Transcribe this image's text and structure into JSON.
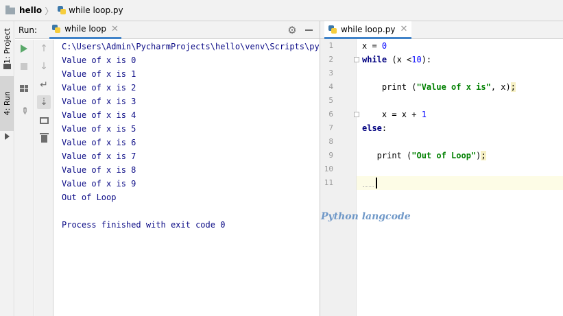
{
  "breadcrumb": {
    "project": "hello",
    "file": "while loop.py"
  },
  "left_strip": {
    "project_tab": "1: Project",
    "run_tab": "4: Run"
  },
  "run_panel": {
    "label": "Run:",
    "tab_label": "while loop",
    "close_glyph": "✕",
    "icons": {
      "settings": "gear-icon",
      "minimize": "minimize-icon",
      "rerun": "rerun-icon",
      "stop": "stop-icon",
      "up": "up-arrow-icon",
      "down": "down-arrow-icon",
      "soft_wrap": "soft-wrap-icon",
      "scroll_to_end": "scroll-to-end-icon",
      "print": "print-icon",
      "clear": "trash-icon",
      "layout": "layout-icon",
      "pin": "pin-icon"
    },
    "console_lines": [
      "C:\\Users\\Admin\\PycharmProjects\\hello\\venv\\Scripts\\pyth",
      "Value of x is 0",
      "Value of x is 1",
      "Value of x is 2",
      "Value of x is 3",
      "Value of x is 4",
      "Value of x is 5",
      "Value of x is 6",
      "Value of x is 7",
      "Value of x is 8",
      "Value of x is 9",
      "Out of Loop",
      "",
      "Process finished with exit code 0"
    ]
  },
  "editor": {
    "tab_label": "while loop.py",
    "close_glyph": "✕",
    "line_numbers": [
      "1",
      "2",
      "3",
      "4",
      "5",
      "6",
      "7",
      "8",
      "9",
      "10",
      "11"
    ],
    "code": {
      "l1_pre": "x = ",
      "l1_num": "0",
      "l2_kw": "while",
      "l2_pre": " (x <",
      "l2_num": "10",
      "l2_post": "):",
      "l4_pre": "    print (",
      "l4_str": "\"Value of x is\"",
      "l4_post": ", x)",
      "l4_semi": ";",
      "l6_pre": "    x = x + ",
      "l6_num": "1",
      "l7_kw": "else",
      "l7_post": ":",
      "l9_pre": "   print (",
      "l9_str": "\"Out of Loop\"",
      "l9_post": ")",
      "l9_semi": ";"
    }
  },
  "watermark": "Python langcode",
  "colors": {
    "accent": "#4083c9",
    "console_text": "#0b0b86",
    "keyword": "#000080",
    "number": "#0000ff",
    "string": "#008000",
    "watermark": "#6f98c8"
  }
}
